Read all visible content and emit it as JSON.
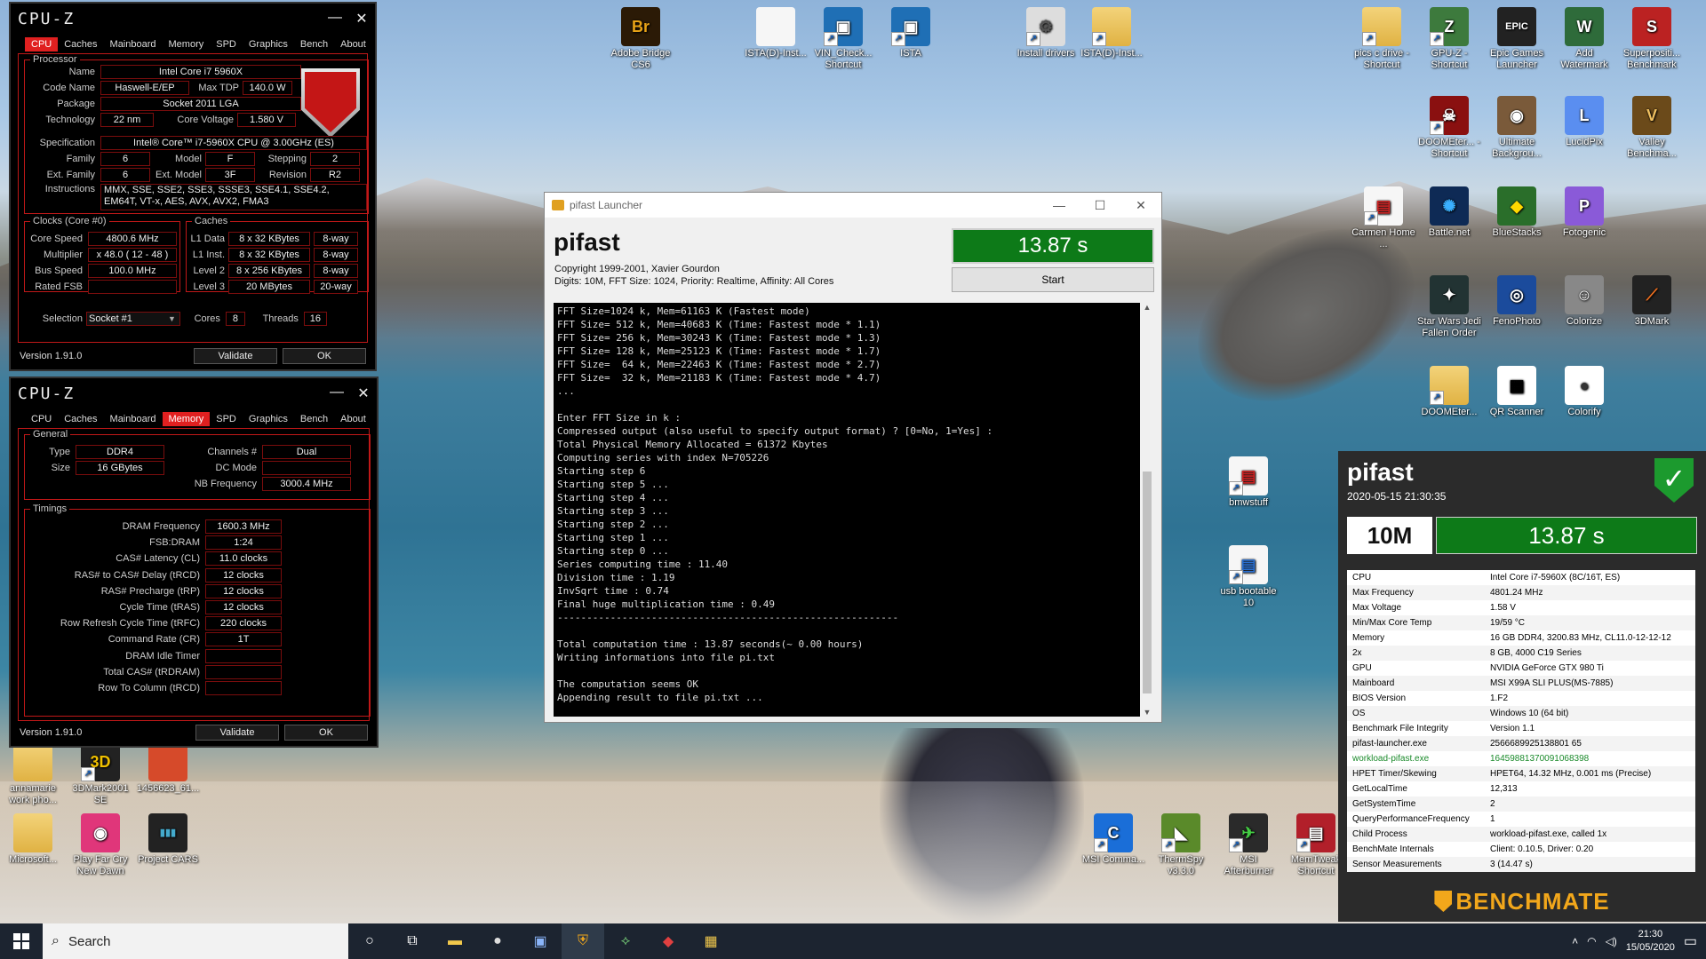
{
  "desktop_icons": [
    {
      "id": "adobe-bridge",
      "label": "Adobe Bridge CS6",
      "glyph": "Br",
      "color": "#2b1a06",
      "fg": "#e8a317"
    },
    {
      "id": "ista-d-inst-doc",
      "label": "ISTA(D)-Inst...",
      "glyph": "",
      "color": "#f6f6f6",
      "fg": "#333"
    },
    {
      "id": "vin-check",
      "label": "VIN_Check... Shortcut",
      "glyph": "▣",
      "color": "#1f6fb5",
      "fg": "#fff"
    },
    {
      "id": "ista",
      "label": "ISTA",
      "glyph": "▣",
      "color": "#1f6fb5",
      "fg": "#fff"
    },
    {
      "id": "install-drivers",
      "label": "Install drivers",
      "glyph": "⚙",
      "color": "#ddd",
      "fg": "#555"
    },
    {
      "id": "ista-d-inst-folder",
      "label": "ISTA(D)-Inst...",
      "glyph": "",
      "color": "#e0b243",
      "fg": "#fff"
    },
    {
      "id": "pics-cdrive",
      "label": "pics c drive - Shortcut",
      "glyph": "",
      "color": "#e0b243",
      "fg": "#fff"
    },
    {
      "id": "gpu-z",
      "label": "GPU-Z - Shortcut",
      "glyph": "Z",
      "color": "#3d7a3d",
      "fg": "#fff"
    },
    {
      "id": "epic-games",
      "label": "Epic Games Launcher",
      "glyph": "EPIC",
      "color": "#222",
      "fg": "#fff"
    },
    {
      "id": "add-watermark",
      "label": "Add Watermark",
      "glyph": "W",
      "color": "#2e6b3a",
      "fg": "#fff"
    },
    {
      "id": "superposition",
      "label": "Superpositi... Benchmark",
      "glyph": "S",
      "color": "#b22",
      "fg": "#fff"
    },
    {
      "id": "doom-eternal-1",
      "label": "DOOMEter... - Shortcut",
      "glyph": "☠",
      "color": "#8a1010",
      "fg": "#fff"
    },
    {
      "id": "ultimate-bg",
      "label": "Ultimate Backgrou...",
      "glyph": "◉",
      "color": "#7a5a3a",
      "fg": "#fff"
    },
    {
      "id": "lucidpix",
      "label": "LucidPix",
      "glyph": "L",
      "color": "#5a8ef0",
      "fg": "#fff"
    },
    {
      "id": "valley",
      "label": "Valley Benchma...",
      "glyph": "V",
      "color": "#6b4a1a",
      "fg": "#f0c060"
    },
    {
      "id": "carmen",
      "label": "Carmen Home ...",
      "glyph": "▤",
      "color": "#f6f6f6",
      "fg": "#c22"
    },
    {
      "id": "battlenet",
      "label": "Battle.net",
      "glyph": "✺",
      "color": "#0e2a55",
      "fg": "#3ab0ff"
    },
    {
      "id": "bluestacks",
      "label": "BlueStacks",
      "glyph": "◆",
      "color": "#2a6e2a",
      "fg": "#ffd800"
    },
    {
      "id": "fotogenic",
      "label": "Fotogenic",
      "glyph": "P",
      "color": "#8a5ad8",
      "fg": "#fff"
    },
    {
      "id": "star-wars",
      "label": "Star Wars Jedi Fallen Order",
      "glyph": "✦",
      "color": "#233",
      "fg": "#fff"
    },
    {
      "id": "fenophoto",
      "label": "FenoPhoto",
      "glyph": "◎",
      "color": "#1b4b9c",
      "fg": "#fff"
    },
    {
      "id": "colorize",
      "label": "Colorize",
      "glyph": "☺",
      "color": "#888",
      "fg": "#fff"
    },
    {
      "id": "3dmark",
      "label": "3DMark",
      "glyph": "⟋",
      "color": "#222",
      "fg": "#f07020"
    },
    {
      "id": "doom-eternal-2",
      "label": "DOOMEter...",
      "glyph": "",
      "color": "#e0b243",
      "fg": "#fff"
    },
    {
      "id": "qr-scanner",
      "label": "QR Scanner",
      "glyph": "▦",
      "color": "#fff",
      "fg": "#000"
    },
    {
      "id": "colorify",
      "label": "Colorify",
      "glyph": "●",
      "color": "#fff",
      "fg": "#333"
    },
    {
      "id": "bmwstuff",
      "label": "bmwstuff",
      "glyph": "▤",
      "color": "#f6f6f6",
      "fg": "#c22"
    },
    {
      "id": "usb-bootable",
      "label": "usb bootable 10",
      "glyph": "▤",
      "color": "#f6f6f6",
      "fg": "#2a6fd0"
    },
    {
      "id": "annamarie",
      "label": "annamarie work pho...",
      "glyph": "",
      "color": "#e0b243",
      "fg": "#fff"
    },
    {
      "id": "3dmark2001",
      "label": "3DMark2001 SE",
      "glyph": "3D",
      "color": "#222",
      "fg": "#f0c000"
    },
    {
      "id": "file-1456623",
      "label": "1456623_61...",
      "glyph": "",
      "color": "#d64a2a",
      "fg": "#fff"
    },
    {
      "id": "microsoft",
      "label": "Microsoft...",
      "glyph": "",
      "color": "#e0b243",
      "fg": "#fff"
    },
    {
      "id": "far-cry",
      "label": "Play Far Cry New Dawn",
      "glyph": "◉",
      "color": "#e0367a",
      "fg": "#fff"
    },
    {
      "id": "project-cars",
      "label": "Project CARS",
      "glyph": "▮▮▮",
      "color": "#222",
      "fg": "#4ac"
    },
    {
      "id": "msi-command",
      "label": "MSI Comma...",
      "glyph": "C",
      "color": "#1a6ed8",
      "fg": "#fff"
    },
    {
      "id": "thermspy",
      "label": "ThermSpy v3.3.0",
      "glyph": "◣",
      "color": "#5a8a2a",
      "fg": "#fff"
    },
    {
      "id": "msi-afterburner",
      "label": "MSI Afterburner",
      "glyph": "✈",
      "color": "#2a2a2a",
      "fg": "#4c4"
    },
    {
      "id": "memtweak",
      "label": "MemTweak Shortcut",
      "glyph": "▤",
      "color": "#b21f2a",
      "fg": "#fff"
    }
  ],
  "cpuz_cpu": {
    "title": "CPU-Z",
    "tabs": [
      "CPU",
      "Caches",
      "Mainboard",
      "Memory",
      "SPD",
      "Graphics",
      "Bench",
      "About"
    ],
    "active_tab": "CPU",
    "processor_legend": "Processor",
    "name_label": "Name",
    "name": "Intel Core i7 5960X",
    "codename_label": "Code Name",
    "codename": "Haswell-E/EP",
    "maxtdp_label": "Max TDP",
    "maxtdp": "140.0 W",
    "package_label": "Package",
    "package": "Socket 2011 LGA",
    "technology_label": "Technology",
    "technology": "22 nm",
    "corevoltage_label": "Core Voltage",
    "corevoltage": "1.580 V",
    "spec_label": "Specification",
    "spec": "Intel® Core™ i7-5960X CPU @ 3.00GHz (ES)",
    "family_label": "Family",
    "family": "6",
    "model_label": "Model",
    "model": "F",
    "stepping_label": "Stepping",
    "stepping": "2",
    "extfamily_label": "Ext. Family",
    "extfamily": "6",
    "extmodel_label": "Ext. Model",
    "extmodel": "3F",
    "revision_label": "Revision",
    "revision": "R2",
    "instructions_label": "Instructions",
    "instructions": "MMX, SSE, SSE2, SSE3, SSSE3, SSE4.1, SSE4.2, EM64T, VT-x, AES, AVX, AVX2, FMA3",
    "clocks_legend": "Clocks (Core #0)",
    "corespeed_label": "Core Speed",
    "corespeed": "4800.6 MHz",
    "multiplier_label": "Multiplier",
    "multiplier": "x 48.0 ( 12 - 48 )",
    "busspeed_label": "Bus Speed",
    "busspeed": "100.0 MHz",
    "ratedfsb_label": "Rated FSB",
    "ratedfsb": "",
    "caches_legend": "Caches",
    "l1d_label": "L1 Data",
    "l1d": "8 x 32 KBytes",
    "l1d_way": "8-way",
    "l1i_label": "L1 Inst.",
    "l1i": "8 x 32 KBytes",
    "l1i_way": "8-way",
    "l2_label": "Level 2",
    "l2": "8 x 256 KBytes",
    "l2_way": "8-way",
    "l3_label": "Level 3",
    "l3": "20 MBytes",
    "l3_way": "20-way",
    "selection_label": "Selection",
    "selection": "Socket #1",
    "cores_label": "Cores",
    "cores": "8",
    "threads_label": "Threads",
    "threads": "16",
    "version": "Version 1.91.0",
    "validate": "Validate",
    "ok": "OK"
  },
  "cpuz_mem": {
    "title": "CPU-Z",
    "tabs": [
      "CPU",
      "Caches",
      "Mainboard",
      "Memory",
      "SPD",
      "Graphics",
      "Bench",
      "About"
    ],
    "active_tab": "Memory",
    "general_legend": "General",
    "type_label": "Type",
    "type": "DDR4",
    "channels_label": "Channels #",
    "channels": "Dual",
    "size_label": "Size",
    "size": "16 GBytes",
    "dcmode_label": "DC Mode",
    "dcmode": "",
    "nbfreq_label": "NB Frequency",
    "nbfreq": "3000.4 MHz",
    "timings_legend": "Timings",
    "timings": [
      {
        "k": "DRAM Frequency",
        "v": "1600.3 MHz"
      },
      {
        "k": "FSB:DRAM",
        "v": "1:24"
      },
      {
        "k": "CAS# Latency (CL)",
        "v": "11.0 clocks"
      },
      {
        "k": "RAS# to CAS# Delay (tRCD)",
        "v": "12 clocks"
      },
      {
        "k": "RAS# Precharge (tRP)",
        "v": "12 clocks"
      },
      {
        "k": "Cycle Time (tRAS)",
        "v": "12 clocks"
      },
      {
        "k": "Row Refresh Cycle Time (tRFC)",
        "v": "220 clocks"
      },
      {
        "k": "Command Rate (CR)",
        "v": "1T"
      },
      {
        "k": "DRAM Idle Timer",
        "v": ""
      },
      {
        "k": "Total CAS# (tRDRAM)",
        "v": ""
      },
      {
        "k": "Row To Column (tRCD)",
        "v": ""
      }
    ],
    "version": "Version 1.91.0",
    "validate": "Validate",
    "ok": "OK"
  },
  "pifast": {
    "window_title": "pifast Launcher",
    "app_name": "pifast",
    "copyright": "Copyright 1999-2001, Xavier Gourdon",
    "params": "Digits: 10M, FFT Size: 1024, Priority: Realtime, Affinity: All Cores",
    "result": "13.87 s",
    "start": "Start",
    "console": "FFT Size=1024 k, Mem=61163 K (Fastest mode)\nFFT Size= 512 k, Mem=40683 K (Time: Fastest mode * 1.1)\nFFT Size= 256 k, Mem=30243 K (Time: Fastest mode * 1.3)\nFFT Size= 128 k, Mem=25123 K (Time: Fastest mode * 1.7)\nFFT Size=  64 k, Mem=22463 K (Time: Fastest mode * 2.7)\nFFT Size=  32 k, Mem=21183 K (Time: Fastest mode * 4.7)\n...\n\nEnter FFT Size in k :\nCompressed output (also useful to specify output format) ? [0=No, 1=Yes] :\nTotal Physical Memory Allocated = 61372 Kbytes\nComputing series with index N=705226\nStarting step 6\nStarting step 5 ...\nStarting step 4 ...\nStarting step 3 ...\nStarting step 2 ...\nStarting step 1 ...\nStarting step 0 ...\nSeries computing time : 11.40\nDivision time : 1.19\nInvSqrt time : 0.74\nFinal huge multiplication time : 0.49\n----------------------------------------------------------\n\nTotal computation time : 13.87 seconds(~ 0.00 hours)\nWriting informations into file pi.txt\n\nThe computation seems OK\nAppending result to file pi.txt ..."
  },
  "benchmate": {
    "title": "pifast",
    "timestamp": "2020-05-15 21:30:35",
    "digits": "10M",
    "result": "13.87 s",
    "brand": "BENCHMATE",
    "rows": [
      {
        "k": "CPU",
        "v": "Intel Core i7-5960X (8C/16T, ES)"
      },
      {
        "k": "Max Frequency",
        "v": "4801.24 MHz"
      },
      {
        "k": "Max Voltage",
        "v": "1.58 V"
      },
      {
        "k": "Min/Max Core Temp",
        "v": "19/59 °C"
      },
      {
        "k": "Memory",
        "v": "16 GB DDR4, 3200.83 MHz, CL11.0-12-12-12"
      },
      {
        "k": "2x",
        "v": "8 GB, 4000 C19 Series"
      },
      {
        "k": "GPU",
        "v": "NVIDIA GeForce GTX 980 Ti"
      },
      {
        "k": "Mainboard",
        "v": "MSI X99A SLI PLUS(MS-7885)"
      },
      {
        "k": "BIOS Version",
        "v": "1.F2"
      },
      {
        "k": "OS",
        "v": "Windows 10 (64 bit)"
      },
      {
        "k": "Benchmark File Integrity",
        "v": "Version 1.1"
      },
      {
        "k": "pifast-launcher.exe",
        "v": "2566689925138801 65"
      },
      {
        "k": "workload-pifast.exe",
        "v": "16459881370091068398",
        "green": true
      },
      {
        "k": "HPET Timer/Skewing",
        "v": "HPET64, 14.32 MHz, 0.001 ms (Precise)"
      },
      {
        "k": "GetLocalTime",
        "v": "12,313"
      },
      {
        "k": "GetSystemTime",
        "v": "2"
      },
      {
        "k": "QueryPerformanceFrequency",
        "v": "1"
      },
      {
        "k": "Child Process",
        "v": "workload-pifast.exe, called 1x"
      },
      {
        "k": "BenchMate Internals",
        "v": "Client: 0.10.5, Driver: 0.20"
      },
      {
        "k": "Sensor Measurements",
        "v": "3 (14.47 s)"
      }
    ]
  },
  "taskbar": {
    "search": "Search",
    "time": "21:30",
    "date": "15/05/2020"
  }
}
